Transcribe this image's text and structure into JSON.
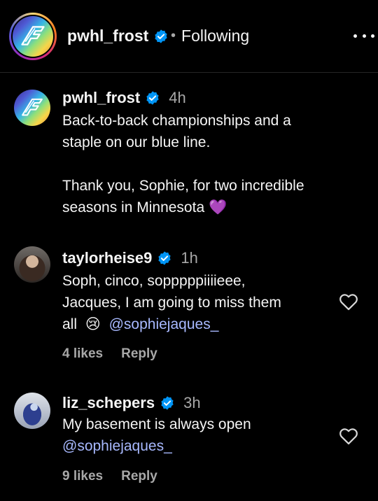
{
  "header": {
    "username": "pwhl_frost",
    "separator": "•",
    "follow_status": "Following"
  },
  "caption": {
    "username": "pwhl_frost",
    "time": "4h",
    "lines": [
      "Back-to-back championships and a",
      "staple on our blue line.",
      "",
      "Thank you, Sophie, for two incredible",
      "seasons in Minnesota"
    ],
    "emoji": "💜"
  },
  "comments": [
    {
      "username": "taylorheise9",
      "time": "1h",
      "lines": [
        "Soph, cinco, sopppppiiiieee,",
        "Jacques, I am going to miss them",
        "all"
      ],
      "emoji": "😢",
      "mention": "@sophiejaques_",
      "likes": "4 likes",
      "reply": "Reply"
    },
    {
      "username": "liz_schepers",
      "time": "3h",
      "lines": [
        "My basement is always open"
      ],
      "mention": "@sophiejaques_",
      "likes": "9 likes",
      "reply": "Reply"
    }
  ],
  "colors": {
    "background": "#000000",
    "verified": "#0095f6",
    "mention": "#a8b9ff",
    "muted": "#a8a8a8"
  }
}
